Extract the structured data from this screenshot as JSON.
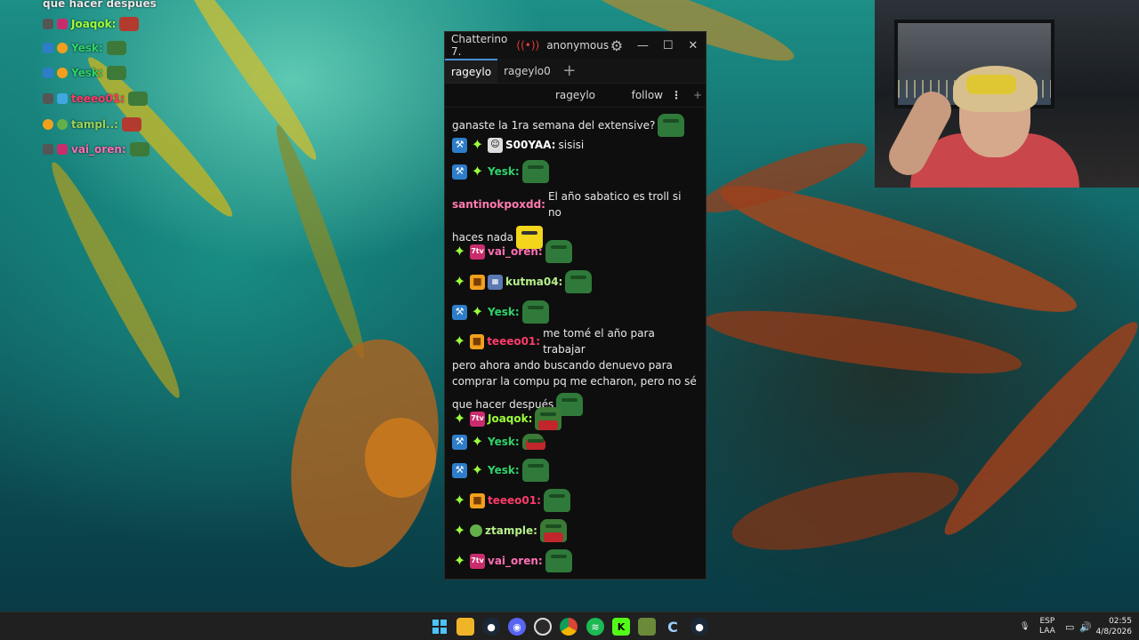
{
  "overlay_chat": {
    "lines": [
      {
        "user": "que hacer después",
        "color": "#ffffff"
      },
      {
        "user": "Joaqok:",
        "color": "#9dff3a"
      },
      {
        "user": "Yesk:",
        "color": "#2fd36b"
      },
      {
        "user": "Yesk:",
        "color": "#2fd36b"
      },
      {
        "user": "teeeo01:",
        "color": "#ff3b6b"
      },
      {
        "user": "tampl..:",
        "color": "#9ad45a"
      },
      {
        "user": "vai_oren:",
        "color": "#ff6fb4"
      }
    ]
  },
  "chat_window": {
    "app_title": "Chatterino 7.",
    "live_icon": "broadcast-icon",
    "user": "anonymous",
    "settings_icon": "gear-icon",
    "tabs": [
      {
        "label": "rageylo",
        "active": true
      },
      {
        "label": "rageylo0",
        "active": false
      }
    ],
    "add_tab": "+",
    "split": {
      "channel": "rageylo",
      "follow": "follow",
      "more": "⋮",
      "add": "+"
    },
    "messages": [
      {
        "user": "",
        "text": "ganaste la 1ra semana del extensive?",
        "color": "#ffffff",
        "emote": "pepe"
      },
      {
        "user": "S00YAA:",
        "text": "sisisi",
        "color": "#ffffff",
        "badges": [
          "mod",
          "star",
          "face"
        ]
      },
      {
        "user": "Yesk:",
        "text": "",
        "color": "#2fd36b",
        "badges": [
          "mod",
          "star"
        ],
        "emote": "pepe"
      },
      {
        "user": "santinokpoxdd:",
        "text": "El año sabatico es troll si no",
        "text2": "haces nada",
        "color": "#ff7bb0",
        "emote": "yellow"
      },
      {
        "user": "vai_oren:",
        "text": "",
        "color": "#ff6fb4",
        "badges": [
          "star",
          "7tv"
        ],
        "emote": "pepe"
      },
      {
        "user": "kutma04:",
        "text": "",
        "color": "#b6f08a",
        "badges": [
          "star",
          "box",
          "img"
        ],
        "emote": "pepe"
      },
      {
        "user": "Yesk:",
        "text": "",
        "color": "#2fd36b",
        "badges": [
          "mod",
          "star"
        ],
        "emote": "pepe"
      },
      {
        "user": "teeeo01:",
        "text": "me tomé el año para trabajar",
        "text2": "pero ahora ando buscando denuevo para",
        "text3": "comprar la compu pq me echaron, pero no sé",
        "text4": "que hacer después",
        "color": "#ff3b6b",
        "badges": [
          "star",
          "box"
        ],
        "emote": "pepe"
      },
      {
        "user": "Joaqok:",
        "text": "",
        "color": "#9dff3a",
        "badges": [
          "star",
          "7tv"
        ],
        "emote": "red"
      },
      {
        "user": "Yesk:",
        "text": "",
        "color": "#2fd36b",
        "badges": [
          "mod",
          "star"
        ],
        "emote": "red"
      },
      {
        "user": "Yesk:",
        "text": "",
        "color": "#2fd36b",
        "badges": [
          "mod",
          "star"
        ],
        "emote": "pepe"
      },
      {
        "user": "teeeo01:",
        "text": "",
        "color": "#ff3b6b",
        "badges": [
          "star",
          "box"
        ],
        "emote": "pepe"
      },
      {
        "user": "ztample:",
        "text": "",
        "color": "#b6f08a",
        "badges": [
          "star",
          "pepe"
        ],
        "emote": "red"
      },
      {
        "user": "vai_oren:",
        "text": "",
        "color": "#ff6fb4",
        "badges": [
          "star",
          "7tv"
        ],
        "emote": "pepe"
      }
    ]
  },
  "taskbar": {
    "icons": [
      "windows-start-icon",
      "file-explorer-icon",
      "steam-icon",
      "discord-icon",
      "obs-icon",
      "chrome-icon",
      "spotify-icon",
      "kick-icon",
      "minecraft-icon",
      "chatterino-icon",
      "steam-client-icon"
    ],
    "tray": {
      "lang_top": "ESP",
      "lang_bottom": "LAA",
      "time": "02:55",
      "date": "4/8/2026"
    }
  }
}
